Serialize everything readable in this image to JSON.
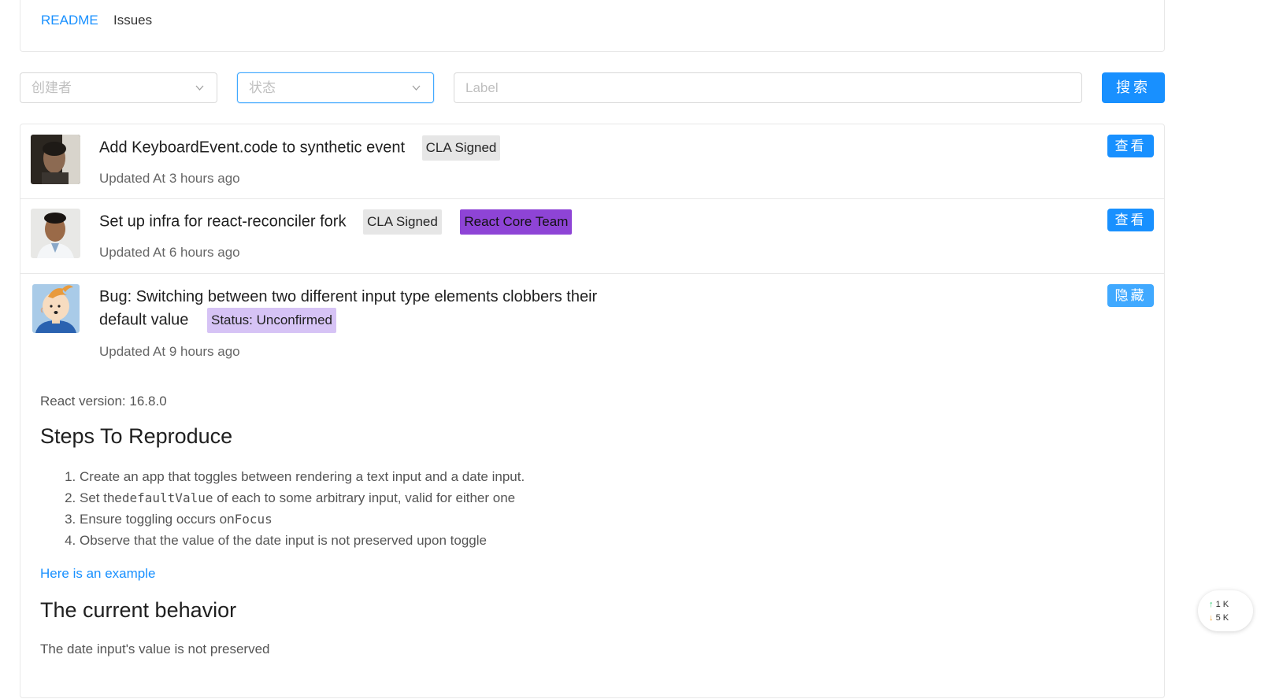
{
  "tabs": {
    "readme": "README",
    "issues": "Issues"
  },
  "filters": {
    "creator_placeholder": "创建者",
    "status_placeholder": "状态",
    "label_placeholder": "Label",
    "search_label": "搜索"
  },
  "issues": [
    {
      "title": "Add KeyboardEvent.code to synthetic event",
      "labels": [
        "CLA Signed"
      ],
      "updated": "Updated At 3 hours ago",
      "action": "查看"
    },
    {
      "title": "Set up infra for react-reconciler fork",
      "labels": [
        "CLA Signed",
        "React Core Team"
      ],
      "updated": "Updated At 6 hours ago",
      "action": "查看"
    },
    {
      "title_line1": "Bug: Switching between two different input type elements clobbers their",
      "title_line2": "default value",
      "labels": [
        "Status: Unconfirmed"
      ],
      "updated": "Updated At 9 hours ago",
      "action": "隐藏"
    }
  ],
  "issue_body": {
    "version": "React version: 16.8.0",
    "steps_heading": "Steps To Reproduce",
    "steps": {
      "s1": "Create an app that toggles between rendering a text input and a date input.",
      "s2_pre": "Set the",
      "s2_code": "defaultValue",
      "s2_post": " of each to some arbitrary input, valid for either one",
      "s3_pre": "Ensure toggling occurs on",
      "s3_code": "Focus",
      "s4": "Observe that the value of the date input is not preserved upon toggle"
    },
    "example_link": "Here is an example",
    "current_heading": "The current behavior",
    "current_text": "The date input's value is not preserved"
  },
  "widget": {
    "up_arrow": "↑",
    "up_value": "1 K",
    "down_arrow": "↓",
    "down_value": "5 K"
  }
}
